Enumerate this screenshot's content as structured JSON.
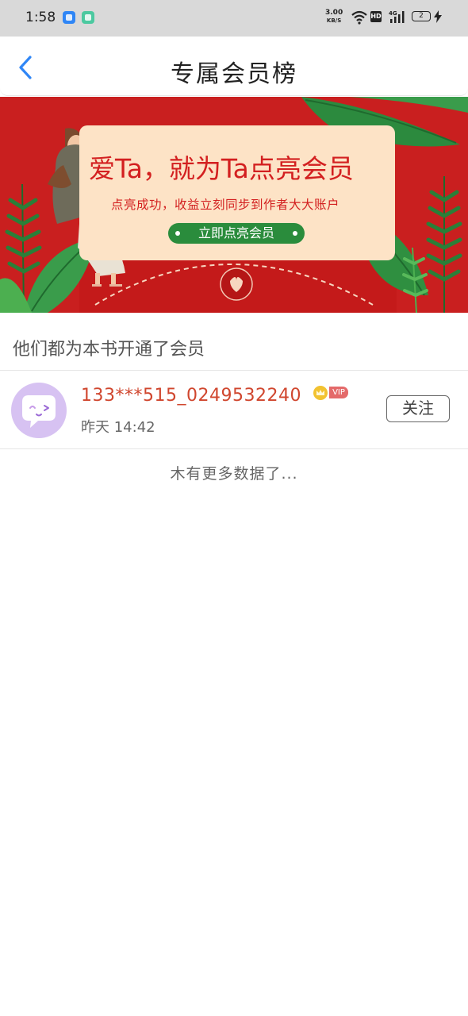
{
  "status_bar": {
    "time": "1:58",
    "net_speed_value": "3.00",
    "net_speed_unit": "KB/S",
    "hd_label": "HD",
    "network_label": "4G",
    "battery_level": "2"
  },
  "header": {
    "title": "专属会员榜"
  },
  "banner": {
    "headline": "爱Ta，就为Ta点亮会员",
    "subtitle": "点亮成功，收益立刻同步到作者大大账户",
    "button_label": "立即点亮会员",
    "colors": {
      "background": "#c91f1f",
      "card": "#fde3c6",
      "button": "#2a8c3c"
    }
  },
  "members_section": {
    "title": "他们都为本书开通了会员",
    "members": [
      {
        "name": "133***515_0249532240",
        "vip_label": "VIP",
        "time": "昨天 14:42",
        "follow_label": "关注"
      }
    ],
    "footer": "木有更多数据了..."
  },
  "colors": {
    "accent_blue": "#2f86f6",
    "name_red": "#d0462e"
  }
}
